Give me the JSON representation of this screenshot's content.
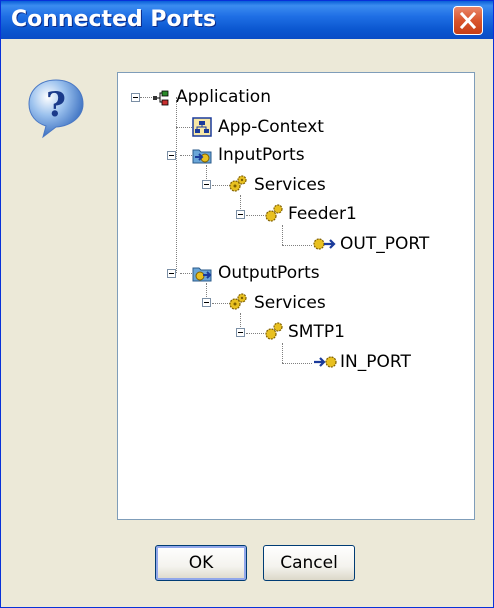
{
  "window": {
    "title": "Connected Ports",
    "colors": {
      "titlebar": "#0a57d0",
      "close": "#d9542c",
      "face": "#ece9d8",
      "tree_border": "#7f9db9"
    }
  },
  "icons": {
    "dialog": "question-icon",
    "close": "close-icon"
  },
  "tree": {
    "application": "Application",
    "app_context": "App-Context",
    "input_ports": "InputPorts",
    "input_services": "Services",
    "feeder": "Feeder1",
    "out_port": "OUT_PORT",
    "output_ports": "OutputPorts",
    "output_services": "Services",
    "smtp": "SMTP1",
    "in_port": "IN_PORT"
  },
  "buttons": {
    "ok": "OK",
    "cancel": "Cancel"
  }
}
